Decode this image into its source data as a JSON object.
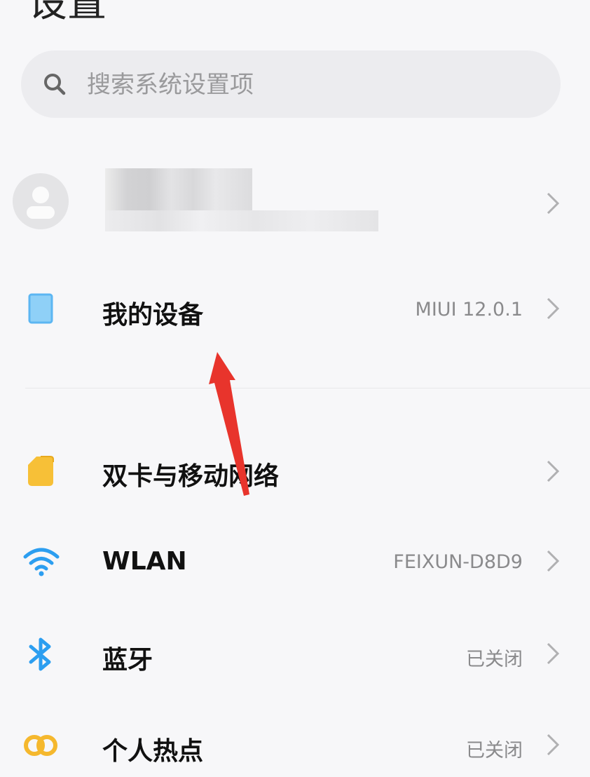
{
  "header": {
    "title": "设置"
  },
  "search": {
    "placeholder": "搜索系统设置项",
    "icon": "search-icon"
  },
  "account": {
    "icon": "avatar-icon"
  },
  "rows": [
    {
      "label": "我的设备",
      "value": "MIUI 12.0.1",
      "icon": "device-icon"
    },
    {
      "label": "双卡与移动网络",
      "value": "",
      "icon": "sim-card-icon"
    },
    {
      "label": "WLAN",
      "value": "FEIXUN-D8D9",
      "icon": "wifi-icon"
    },
    {
      "label": "蓝牙",
      "value": "已关闭",
      "icon": "bluetooth-icon"
    },
    {
      "label": "个人热点",
      "value": "已关闭",
      "icon": "hotspot-icon"
    }
  ],
  "colors": {
    "device": "#5cb6f2",
    "sim": "#f7c037",
    "wifi": "#2c9ef0",
    "bluetooth": "#2c9ef0",
    "hotspot": "#f5b82e",
    "annotation_arrow": "#e8342c"
  }
}
